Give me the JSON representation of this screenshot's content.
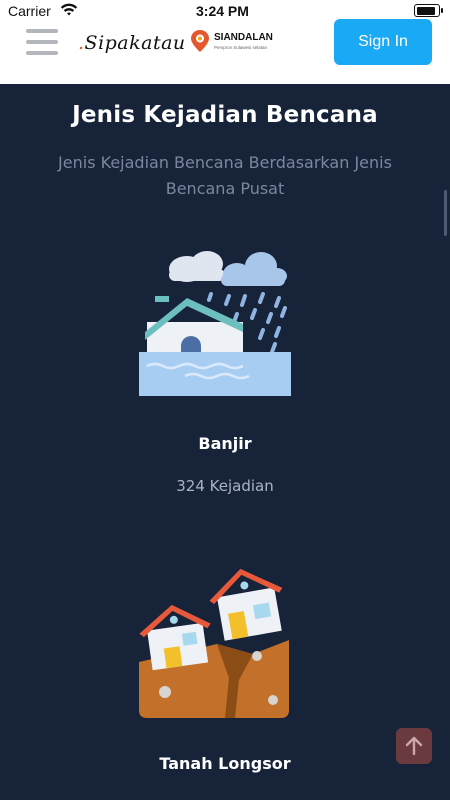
{
  "statusbar": {
    "carrier": "Carrier",
    "time": "3:24 PM"
  },
  "navbar": {
    "logo_primary": "Sipakatau",
    "logo_secondary": "SIANDALAN",
    "logo_secondary_tag": "Pemprov Sulawesi selatan",
    "signin_label": "Sign In"
  },
  "main": {
    "title": "Jenis Kejadian Bencana",
    "subtitle": "Jenis Kejadian Bencana Berdasarkan Jenis Bencana Pusat",
    "cards": [
      {
        "name": "Banjir",
        "count": "324 Kejadian",
        "icon": "flood-icon"
      },
      {
        "name": "Tanah Longsor",
        "count": "",
        "icon": "landslide-icon"
      }
    ]
  },
  "colors": {
    "background": "#172339",
    "accent": "#1aa9f5",
    "back_to_top": "#6b3a3e"
  }
}
